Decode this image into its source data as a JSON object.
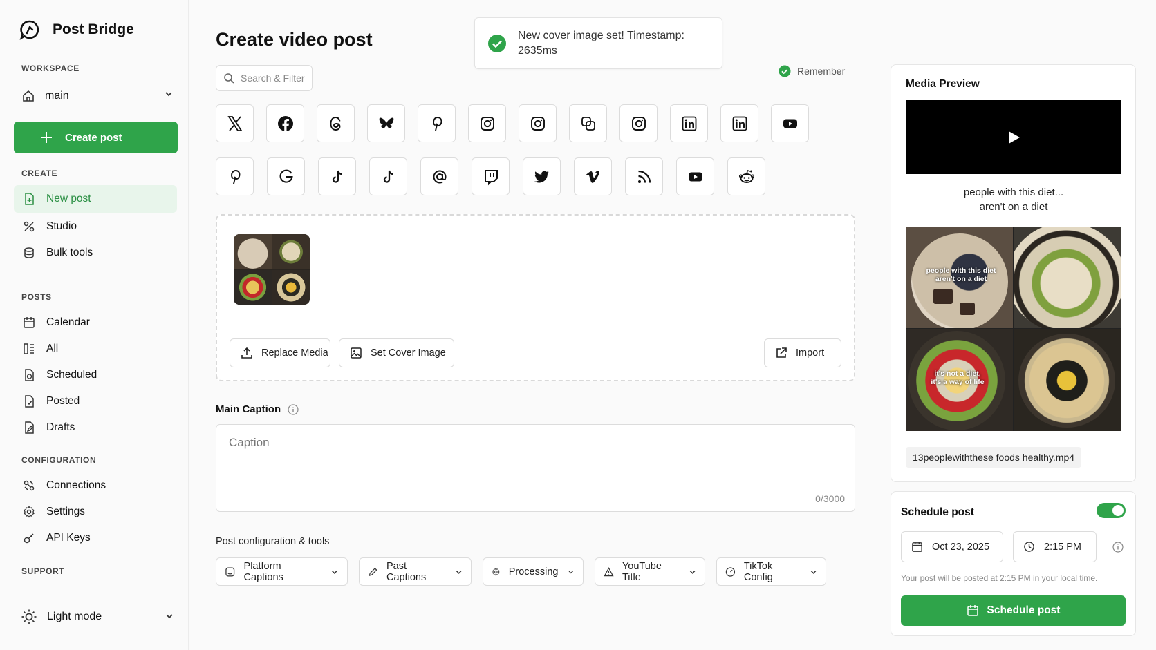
{
  "brand": {
    "name": "Post Bridge"
  },
  "sidebar": {
    "workspace_label": "WORKSPACE",
    "workspace_value": "main",
    "create_button": "Create post",
    "create_label": "CREATE",
    "create_items": [
      {
        "label": "New post",
        "icon": "file-plus-icon"
      },
      {
        "label": "Studio",
        "icon": "percent-icon"
      },
      {
        "label": "Bulk tools",
        "icon": "layers-icon"
      }
    ],
    "posts_label": "POSTS",
    "posts_items": [
      {
        "label": "Calendar",
        "icon": "calendar-icon"
      },
      {
        "label": "All",
        "icon": "list-icon"
      },
      {
        "label": "Scheduled",
        "icon": "file-clock-icon"
      },
      {
        "label": "Posted",
        "icon": "file-check-icon"
      },
      {
        "label": "Drafts",
        "icon": "file-pen-icon"
      }
    ],
    "config_label": "CONFIGURATION",
    "config_items": [
      {
        "label": "Connections",
        "icon": "link-icon"
      },
      {
        "label": "Settings",
        "icon": "gear-icon"
      },
      {
        "label": "API Keys",
        "icon": "key-icon"
      }
    ],
    "support_label": "SUPPORT",
    "theme_label": "Light mode"
  },
  "main": {
    "title": "Create video post",
    "search_placeholder": "Search & Filter",
    "toast": "New cover image set! Timestamp: 2635ms",
    "remember": "Remember",
    "media_buttons": {
      "replace": "Replace Media",
      "cover": "Set Cover Image",
      "import": "Import"
    },
    "caption_label": "Main Caption",
    "caption_placeholder": "Caption",
    "caption_count": "0/3000",
    "config_label": "Post configuration & tools",
    "config_buttons": [
      "Platform Captions",
      "Past Captions",
      "Processing",
      "YouTube Title",
      "TikTok Config"
    ]
  },
  "preview": {
    "title": "Media Preview",
    "video_caption_line1": "people with this diet...",
    "video_caption_line2": "aren't on a diet",
    "collage_text_1": "people with this diet",
    "collage_text_2": "aren't on a diet",
    "collage_text_3": "it's not a diet,",
    "collage_text_4": "it's a way of life",
    "filename": "13peoplewiththese foods healthy.mp4"
  },
  "schedule": {
    "title": "Schedule post",
    "date": "Oct 23, 2025",
    "time": "2:15 PM",
    "note": "Your post will be posted at 2:15 PM in your local time.",
    "button": "Schedule post"
  },
  "colors": {
    "accent": "#2fa44a",
    "accent_light": "#e8f5eb"
  }
}
